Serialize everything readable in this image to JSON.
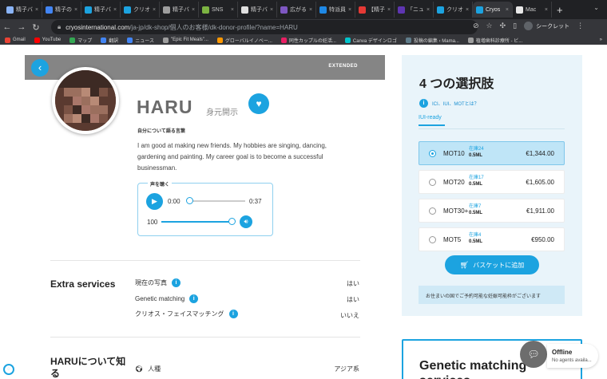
{
  "tabs": [
    {
      "title": "精子バ",
      "color": "#8ab4f8"
    },
    {
      "title": "精子の",
      "color": "#4285f4"
    },
    {
      "title": "精子バ",
      "color": "#1ca3e0"
    },
    {
      "title": "クリオ",
      "color": "#1ca3e0"
    },
    {
      "title": "精子バ",
      "color": "#9e9e9e"
    },
    {
      "title": "SNS",
      "color": "#7cb342"
    },
    {
      "title": "精子バ",
      "color": "#e0e0e0"
    },
    {
      "title": "広がる",
      "color": "#7e57c2"
    },
    {
      "title": "特派員",
      "color": "#1e88e5"
    },
    {
      "title": "【精子",
      "color": "#e53935"
    },
    {
      "title": "「ニュ",
      "color": "#5e35b1"
    },
    {
      "title": "クリオ",
      "color": "#1ca3e0"
    },
    {
      "title": "Cryos",
      "color": "#1ca3e0",
      "active": true
    },
    {
      "title": "Mac",
      "color": "#e8e8e8"
    }
  ],
  "address": {
    "host": "cryosinternational.com",
    "path": "/ja-jp/dk-shop/個人のお客様/dk-donor-profile/?name=HARU"
  },
  "incognito_label": "シークレット",
  "bookmarks": [
    {
      "label": "Gmail",
      "color": "#ea4335"
    },
    {
      "label": "YouTube",
      "color": "#ff0000"
    },
    {
      "label": "マップ",
      "color": "#34a853"
    },
    {
      "label": "翻訳",
      "color": "#4285f4"
    },
    {
      "label": "ニュース",
      "color": "#4285f4"
    },
    {
      "label": "\"Epic Fit Meals\"...",
      "color": "#9e9e9e"
    },
    {
      "label": "グローバルイノベー...",
      "color": "#ff9800"
    },
    {
      "label": "同性カップルの妊活...",
      "color": "#e91e63"
    },
    {
      "label": "Canva デザインロゴ",
      "color": "#00c4cc"
    },
    {
      "label": "投稿の編集 ‹ Mama...",
      "color": "#607d8b"
    },
    {
      "label": "植増歯科診療所 - ビ...",
      "color": "#9e9e9e"
    }
  ],
  "profile": {
    "extended": "EXTENDED",
    "name": "HARU",
    "id_status": "身元開示",
    "about_label": "自分について語る言葉",
    "description": "I am good at making new friends. My hobbies are singing, dancing, gardening and painting. My career goal is to become a successful businessman.",
    "voice": {
      "label": "声を聴く",
      "current": "0:00",
      "duration": "0:37",
      "volume": "100",
      "volume_level": 100,
      "progress": 0
    }
  },
  "extra": {
    "title": "Extra services",
    "rows": [
      {
        "label": "現在の写真",
        "value": "はい"
      },
      {
        "label": "Genetic matching",
        "value": "はい"
      },
      {
        "label": "クリオス・フェイスマッチング",
        "value": "いいえ"
      }
    ]
  },
  "about": {
    "title": "HARUについて知る",
    "row_label": "人種",
    "row_value": "アジア系"
  },
  "options_panel": {
    "title": "4 つの選択肢",
    "info": "ICI、IUI、MOTとは？",
    "tab": "IUI-ready",
    "items": [
      {
        "name": "MOT10",
        "stock": "在庫24",
        "volume": "0.5ML",
        "price": "€1,344.00",
        "selected": true
      },
      {
        "name": "MOT20",
        "stock": "在庫17",
        "volume": "0.5ML",
        "price": "€1,605.00",
        "selected": false
      },
      {
        "name": "MOT30+",
        "stock": "在庫7",
        "volume": "0.5ML",
        "price": "€1,911.00",
        "selected": false
      },
      {
        "name": "MOT5",
        "stock": "在庫4",
        "volume": "0.5ML",
        "price": "€950.00",
        "selected": false
      }
    ],
    "cart": "バスケットに追加",
    "note": "お住まいの国でご予約可能な妊娠可能枠がございます"
  },
  "genetic": {
    "title": "Genetic matching services"
  },
  "chat": {
    "status": "Offline",
    "sub": "No agents availa..."
  },
  "colors": {
    "accent": "#1ca3e0",
    "header_gray": "#858585",
    "panel_bg": "#e9f4fa"
  }
}
